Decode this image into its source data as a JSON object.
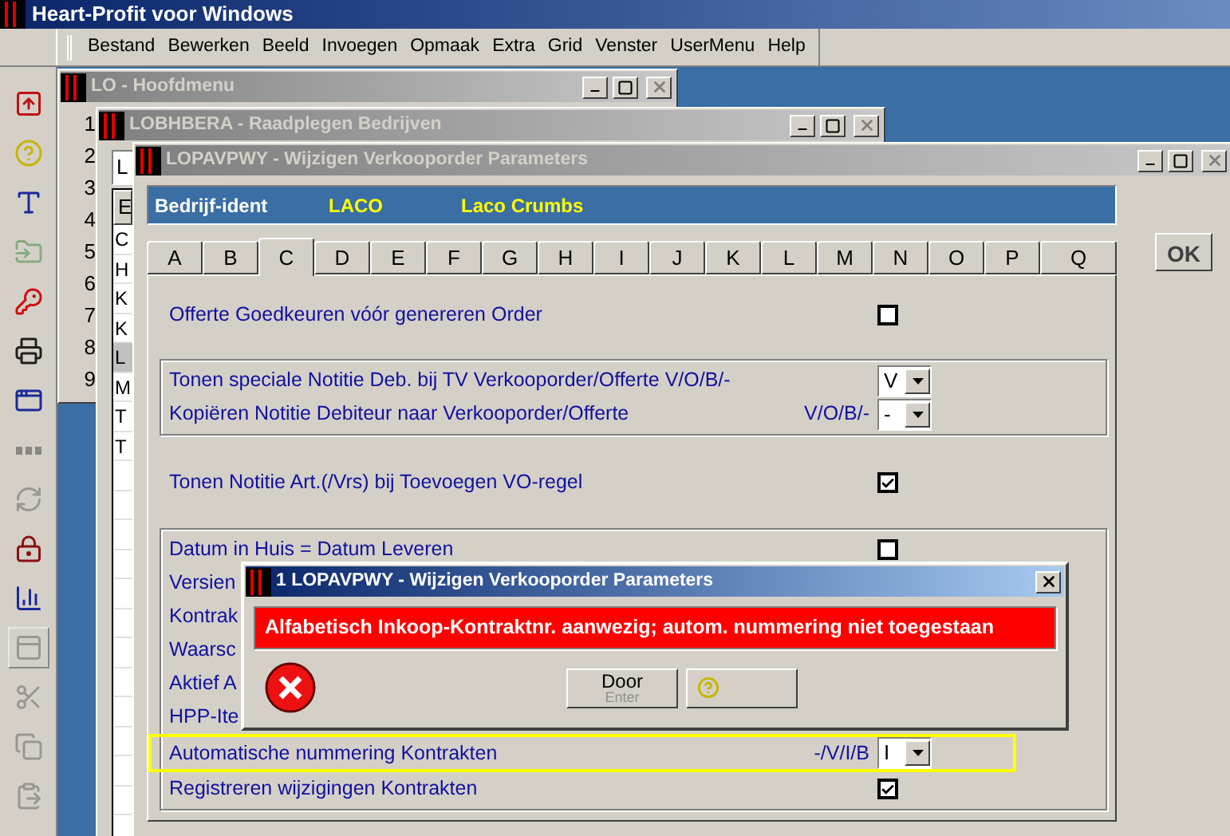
{
  "app": {
    "title": "Heart-Profit voor Windows"
  },
  "menu": [
    "Bestand",
    "Bewerken",
    "Beeld",
    "Invoegen",
    "Opmaak",
    "Extra",
    "Grid",
    "Venster",
    "UserMenu",
    "Help"
  ],
  "toolbar": [
    {
      "kind": "export",
      "disabled": false,
      "pressed": false
    },
    {
      "kind": "help",
      "disabled": false,
      "pressed": false
    },
    {
      "kind": "font",
      "disabled": false,
      "pressed": false
    },
    {
      "kind": "folder",
      "disabled": true,
      "pressed": false
    },
    {
      "kind": "key",
      "disabled": false,
      "pressed": false
    },
    {
      "kind": "printer",
      "disabled": false,
      "pressed": false
    },
    {
      "kind": "window",
      "disabled": false,
      "pressed": false
    },
    {
      "kind": "dots",
      "disabled": true,
      "pressed": false
    },
    {
      "kind": "refresh",
      "disabled": true,
      "pressed": false
    },
    {
      "kind": "lock",
      "disabled": false,
      "pressed": false
    },
    {
      "kind": "chart",
      "disabled": false,
      "pressed": false
    },
    {
      "kind": "panel",
      "disabled": true,
      "pressed": true
    },
    {
      "kind": "scissors",
      "disabled": true,
      "pressed": false
    },
    {
      "kind": "copy",
      "disabled": true,
      "pressed": false
    },
    {
      "kind": "paste",
      "disabled": true,
      "pressed": false
    }
  ],
  "main_menu_window": {
    "title": "LO - Hoofdmenu",
    "active": false,
    "numbers": [
      "1",
      "2",
      "3",
      "4",
      "5",
      "6",
      "7",
      "8",
      "9"
    ]
  },
  "companies_window": {
    "title": "LOBHBERA - Raadplegen Bedrijven",
    "active": false,
    "field": "L",
    "column_1": "E",
    "rows": [
      {
        "cell": "C",
        "selected": false
      },
      {
        "cell": "H",
        "selected": false
      },
      {
        "cell": "K",
        "selected": false
      },
      {
        "cell": "K",
        "selected": false
      },
      {
        "cell": "L",
        "selected": true
      },
      {
        "cell": "M",
        "selected": false
      },
      {
        "cell": "T",
        "selected": false
      },
      {
        "cell": "T",
        "selected": false
      }
    ]
  },
  "parameters_window": {
    "title": "LOPAVPWY - Wijzigen Verkooporder Parameters",
    "active": false,
    "company": {
      "label": "Bedrijf-ident",
      "code": "LACO",
      "name": "Laco Crumbs"
    },
    "ok_button": "OK",
    "tabs": [
      {
        "label": "A",
        "selected": false
      },
      {
        "label": "B",
        "selected": false
      },
      {
        "label": "C",
        "selected": true
      },
      {
        "label": "D",
        "selected": false
      },
      {
        "label": "E",
        "selected": false
      },
      {
        "label": "F",
        "selected": false
      },
      {
        "label": "G",
        "selected": false
      },
      {
        "label": "H",
        "selected": false
      },
      {
        "label": "I",
        "selected": false
      },
      {
        "label": "J",
        "selected": false
      },
      {
        "label": "K",
        "selected": false
      },
      {
        "label": "L",
        "selected": false
      },
      {
        "label": "M",
        "selected": false
      },
      {
        "label": "N",
        "selected": false
      },
      {
        "label": "O",
        "selected": false
      },
      {
        "label": "P",
        "selected": false
      },
      {
        "label": "Q",
        "selected": false
      }
    ],
    "sections": [
      {
        "kind": "row",
        "label": "Offerte Goedkeuren vóór genereren Order",
        "highlighted": false,
        "control": {
          "kind": "checkbox",
          "checked": false
        }
      },
      {
        "kind": "group",
        "rows": [
          {
            "label": "Tonen speciale Notitie Deb. bij TV Verkooporder/Offerte V/O/B/-",
            "highlighted": false,
            "control": {
              "kind": "combo",
              "value": "V"
            }
          },
          {
            "label": "Kopiëren Notitie Debiteur naar Verkooporder/Offerte",
            "suffix": "V/O/B/-",
            "highlighted": false,
            "control": {
              "kind": "combo",
              "value": "-"
            }
          }
        ]
      },
      {
        "kind": "row",
        "label": "Tonen Notitie Art.(/Vrs) bij Toevoegen VO-regel",
        "highlighted": false,
        "control": {
          "kind": "checkbox",
          "checked": true
        }
      },
      {
        "kind": "group",
        "rows": [
          {
            "label": "Datum in Huis = Datum Leveren",
            "highlighted": false,
            "control": {
              "kind": "checkbox",
              "checked": false
            }
          },
          {
            "label": "Versien",
            "highlighted": false
          },
          {
            "label": "Kontrak",
            "highlighted": false
          },
          {
            "label": "Waarsc",
            "highlighted": false
          },
          {
            "label": "Aktief A",
            "highlighted": false
          },
          {
            "label": "HPP-Ite",
            "highlighted": false
          },
          {
            "label": "Automatische nummering Kontrakten",
            "suffix": "-/V/I/B",
            "highlighted": true,
            "control": {
              "kind": "combo",
              "value": "I"
            }
          },
          {
            "label": "Registreren wijzigingen Kontrakten",
            "highlighted": false,
            "control": {
              "kind": "checkbox",
              "checked": true
            }
          }
        ]
      }
    ]
  },
  "dialog": {
    "title": "1 LOPAVPWY - Wijzigen Verkooporder Parameters",
    "active": true,
    "message": "Alfabetisch Inkoop-Kontraktnr. aanwezig; autom. nummering niet toegestaan",
    "button": "Door",
    "button_hint": "Enter"
  }
}
